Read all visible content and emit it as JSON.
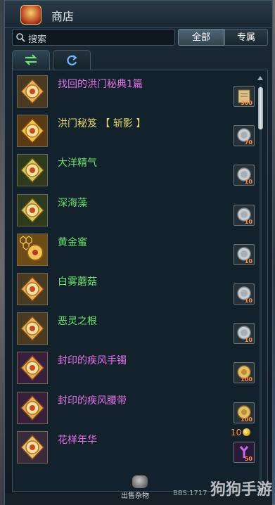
{
  "window": {
    "title": "商店"
  },
  "search": {
    "placeholder": "搜索"
  },
  "filters": {
    "all_label": "全部",
    "exclusive_label": "专属"
  },
  "tabs": [
    {
      "icon": "swap-arrows-icon"
    },
    {
      "icon": "refresh-icon"
    }
  ],
  "items": [
    {
      "name": "找回的洪门秘典1篇",
      "color": "#e271e6",
      "icon_style": "seal-brown",
      "cost_type": "scroll",
      "qty": "300"
    },
    {
      "name": "洪门秘笈 【 斩影 】",
      "color": "#e6d76f",
      "icon_style": "seal-gold",
      "cost_type": "silver-coin",
      "qty": "70"
    },
    {
      "name": "大洋精气",
      "color": "#6ee26e",
      "icon_style": "seal-green",
      "cost_type": "silver-coin",
      "qty": "10"
    },
    {
      "name": "深海藻",
      "color": "#6ee26e",
      "icon_style": "seal-green",
      "cost_type": "silver-coin",
      "qty": "10"
    },
    {
      "name": "黄金蜜",
      "color": "#6ee26e",
      "icon_style": "honeycomb",
      "cost_type": "silver-coin",
      "qty": "10"
    },
    {
      "name": "白雾蘑菇",
      "color": "#6ee26e",
      "icon_style": "seal-brown",
      "cost_type": "silver-coin",
      "qty": "10"
    },
    {
      "name": "恶灵之根",
      "color": "#6ee26e",
      "icon_style": "seal-brown",
      "cost_type": "silver-coin",
      "qty": "10"
    },
    {
      "name": "封印的疾风手镯",
      "color": "#e271e6",
      "icon_style": "seal-purple",
      "cost_type": "gold-medal",
      "qty": "100"
    },
    {
      "name": "封印的疾风腰带",
      "color": "#e271e6",
      "icon_style": "seal-purple",
      "cost_type": "gold-medal",
      "qty": "100"
    },
    {
      "name": "花样年华",
      "color": "#e271e6",
      "icon_style": "costume",
      "cost_type": "purple-key",
      "qty": "50",
      "price": "10"
    }
  ],
  "footer": {
    "sell_label": "出售杂物"
  },
  "watermark": {
    "text": "狗狗手游",
    "sub": "BBS.1717"
  }
}
